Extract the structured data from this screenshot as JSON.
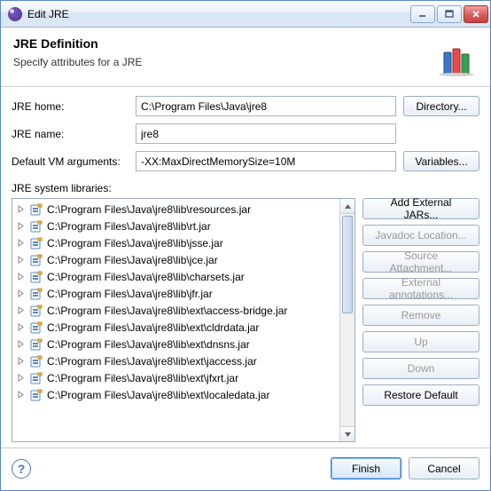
{
  "window": {
    "title": "Edit JRE"
  },
  "header": {
    "title": "JRE Definition",
    "subtitle": "Specify attributes for a JRE"
  },
  "form": {
    "home_label": "JRE home:",
    "home_value": "C:\\Program Files\\Java\\jre8",
    "home_button": "Directory...",
    "name_label": "JRE name:",
    "name_value": "jre8",
    "args_label": "Default VM arguments:",
    "args_value": "-XX:MaxDirectMemorySize=10M",
    "args_button": "Variables..."
  },
  "syslib": {
    "label": "JRE system libraries:",
    "items": [
      "C:\\Program Files\\Java\\jre8\\lib\\resources.jar",
      "C:\\Program Files\\Java\\jre8\\lib\\rt.jar",
      "C:\\Program Files\\Java\\jre8\\lib\\jsse.jar",
      "C:\\Program Files\\Java\\jre8\\lib\\jce.jar",
      "C:\\Program Files\\Java\\jre8\\lib\\charsets.jar",
      "C:\\Program Files\\Java\\jre8\\lib\\jfr.jar",
      "C:\\Program Files\\Java\\jre8\\lib\\ext\\access-bridge.jar",
      "C:\\Program Files\\Java\\jre8\\lib\\ext\\cldrdata.jar",
      "C:\\Program Files\\Java\\jre8\\lib\\ext\\dnsns.jar",
      "C:\\Program Files\\Java\\jre8\\lib\\ext\\jaccess.jar",
      "C:\\Program Files\\Java\\jre8\\lib\\ext\\jfxrt.jar",
      "C:\\Program Files\\Java\\jre8\\lib\\ext\\localedata.jar"
    ],
    "buttons": {
      "add_external": "Add External JARs...",
      "javadoc": "Javadoc Location...",
      "source": "Source Attachment...",
      "annotations": "External annotations...",
      "remove": "Remove",
      "up": "Up",
      "down": "Down",
      "restore": "Restore Default"
    }
  },
  "footer": {
    "finish": "Finish",
    "cancel": "Cancel"
  }
}
